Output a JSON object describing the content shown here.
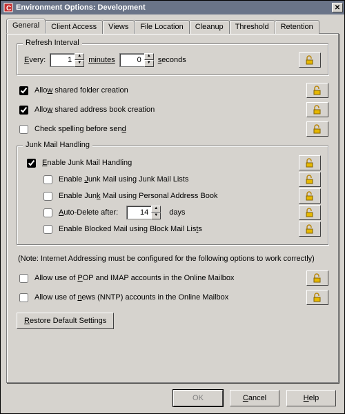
{
  "window": {
    "title": "Environment Options:  Development"
  },
  "tabs": {
    "t0": "General",
    "t1": "Client Access",
    "t2": "Views",
    "t3": "File Location",
    "t4": "Cleanup",
    "t5": "Threshold",
    "t6": "Retention"
  },
  "refresh": {
    "legend": "Refresh Interval",
    "every_prefix": "E",
    "every_rest": "very:",
    "minutes_value": "1",
    "minutes": "minutes",
    "seconds_value": "0",
    "seconds_u": "s",
    "seconds_rest": "econds"
  },
  "opts": {
    "shared_folder": {
      "checked": true,
      "pre": "Allo",
      "u": "w",
      "post": " shared folder creation"
    },
    "shared_addr": {
      "checked": true,
      "pre": "Allo",
      "u": "w",
      "post": " shared address book creation"
    },
    "spellcheck": {
      "checked": false,
      "pre": "Check spelling before sen",
      "u": "d",
      "post": ""
    }
  },
  "junk": {
    "legend": "Junk Mail Handling",
    "enable": {
      "checked": true,
      "u": "E",
      "post": "nable Junk Mail Handling"
    },
    "lists": {
      "checked": false,
      "pre": "Enable ",
      "u": "J",
      "post": "unk Mail using Junk Mail Lists"
    },
    "pab": {
      "checked": false,
      "pre": "Enable Jun",
      "u": "k",
      "post": " Mail using Personal Address Book"
    },
    "auto": {
      "checked": false,
      "u": "A",
      "post": "uto-Delete after:",
      "days_value": "14",
      "days_label": "days"
    },
    "block": {
      "checked": false,
      "pre": "Enable Blocked Mail using Block Mail Lis",
      "u": "t",
      "post": "s"
    }
  },
  "note_text": "(Note: Internet Addressing must be configured for the following options to work correctly)",
  "online": {
    "pop": {
      "checked": false,
      "pre": "Allow use of ",
      "u": "P",
      "post": "OP and IMAP accounts in the Online Mailbox"
    },
    "nntp": {
      "checked": false,
      "pre": "Allow use of ",
      "u": "n",
      "post": "ews (NNTP) accounts in the Online Mailbox"
    }
  },
  "restore": {
    "u": "R",
    "post": "estore Default Settings"
  },
  "buttons": {
    "ok": "OK",
    "cancel_u": "C",
    "cancel_post": "ancel",
    "help_u": "H",
    "help_post": "elp"
  }
}
